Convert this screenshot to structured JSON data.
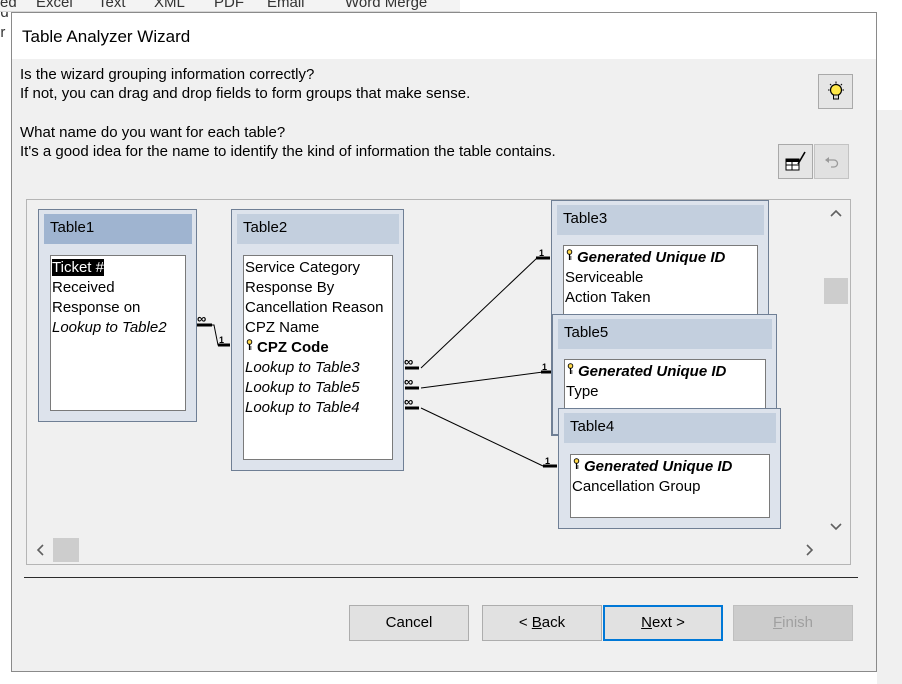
{
  "background": {
    "ribbon_items": [
      "ed",
      "Excel",
      "Text",
      "XML",
      "PDF",
      "Email",
      "Word Merge"
    ],
    "left_text": [
      "ed",
      "or"
    ]
  },
  "dialog": {
    "title": "Table Analyzer Wizard",
    "question1": "Is the wizard grouping information correctly?",
    "question2": "If not, you can drag and drop fields to form groups that make sense.",
    "question3": "What name do you want for each table?",
    "question4": "It's a good idea for the name to identify the kind of information the table contains.",
    "icons": {
      "tips": "lightbulb-icon",
      "rename": "rename-table-icon",
      "undo": "undo-icon"
    }
  },
  "tables": {
    "table1": {
      "name": "Table1",
      "fields": [
        "Ticket #",
        "Received",
        "Response on",
        "Lookup to Table2"
      ]
    },
    "table2": {
      "name": "Table2",
      "fields": [
        "Service Category",
        "Response By",
        "Cancellation Reason",
        "CPZ Name",
        "CPZ Code",
        "Lookup to Table3",
        "Lookup to Table5",
        "Lookup to Table4"
      ]
    },
    "table3": {
      "name": "Table3",
      "fields": [
        "Generated Unique ID",
        "Serviceable",
        "Action Taken"
      ]
    },
    "table5": {
      "name": "Table5",
      "fields": [
        "Generated Unique ID",
        "Type"
      ]
    },
    "table4": {
      "name": "Table4",
      "fields": [
        "Generated Unique ID",
        "Cancellation Group"
      ]
    }
  },
  "relationships": {
    "one": "1",
    "many": "∞"
  },
  "buttons": {
    "cancel": "Cancel",
    "back_prefix": "< ",
    "back_key": "B",
    "back_rest": "ack",
    "next_key": "N",
    "next_rest": "ext >",
    "finish_key": "F",
    "finish_rest": "inish"
  }
}
